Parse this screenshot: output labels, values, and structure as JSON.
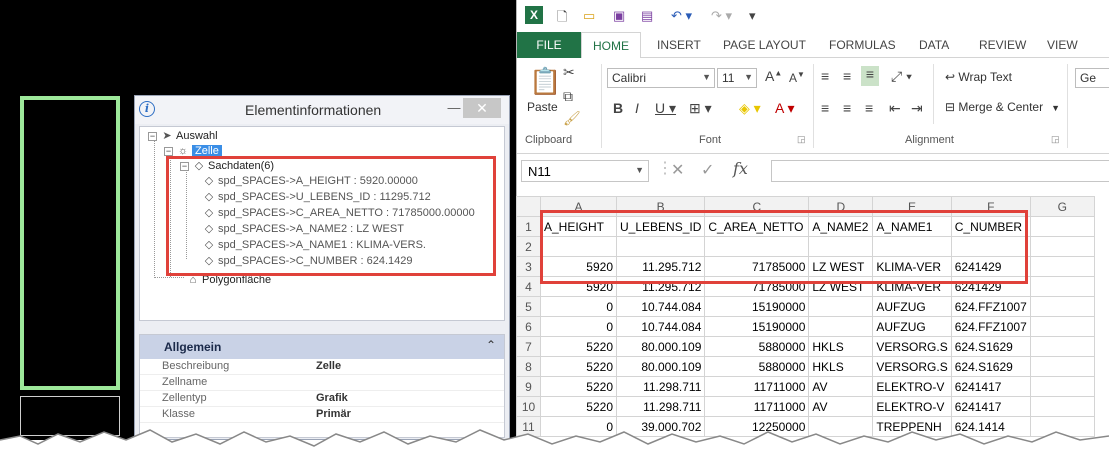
{
  "element_info": {
    "title": "Elementinformationen",
    "tree": {
      "root": "Auswahl",
      "cell": "Zelle",
      "sachdaten": "Sachdaten(6)",
      "items": [
        "spd_SPACES->A_HEIGHT : 5920.00000",
        "spd_SPACES->U_LEBENS_ID : 11295.712",
        "spd_SPACES->C_AREA_NETTO : 71785000.00000",
        "spd_SPACES->A_NAME2 : LZ WEST",
        "spd_SPACES->A_NAME1 : KLIMA-VERS.",
        "spd_SPACES->C_NUMBER : 624.1429"
      ],
      "polygon": "Polygonfläche"
    },
    "section": {
      "title": "Allgemein",
      "rows": [
        {
          "key": "Beschreibung",
          "value": "Zelle"
        },
        {
          "key": "Zellname",
          "value": ""
        },
        {
          "key": "Zellentyp",
          "value": "Grafik"
        },
        {
          "key": "Klasse",
          "value": "Primär"
        }
      ]
    }
  },
  "excel": {
    "tabs": [
      "FILE",
      "HOME",
      "INSERT",
      "PAGE LAYOUT",
      "FORMULAS",
      "DATA",
      "REVIEW",
      "VIEW"
    ],
    "ribbon": {
      "paste": "Paste",
      "clipboard": "Clipboard",
      "font_name": "Calibri",
      "font_size": "11",
      "font_group": "Font",
      "wrap_text": "Wrap Text",
      "merge_center": "Merge & Center",
      "alignment": "Alignment",
      "general_box": "Ge"
    },
    "name_box": "N11",
    "fx": "fx",
    "columns": [
      "A",
      "B",
      "C",
      "D",
      "E",
      "F",
      "G"
    ],
    "rows": [
      {
        "n": "1",
        "cells": [
          "A_HEIGHT",
          "U_LEBENS_ID",
          "C_AREA_NETTO",
          "A_NAME2",
          "A_NAME1",
          "C_NUMBER",
          ""
        ]
      },
      {
        "n": "2",
        "cells": [
          "",
          "",
          "",
          "",
          "",
          "",
          ""
        ]
      },
      {
        "n": "3",
        "cells": [
          "5920",
          "11.295.712",
          "71785000",
          "LZ WEST",
          "KLIMA-VER",
          "6241429",
          ""
        ]
      },
      {
        "n": "4",
        "cells": [
          "5920",
          "11.295.712",
          "71785000",
          "LZ WEST",
          "KLIMA-VER",
          "6241429",
          ""
        ]
      },
      {
        "n": "5",
        "cells": [
          "0",
          "10.744.084",
          "15190000",
          "",
          "AUFZUG",
          "624.FFZ1007",
          ""
        ]
      },
      {
        "n": "6",
        "cells": [
          "0",
          "10.744.084",
          "15190000",
          "",
          "AUFZUG",
          "624.FFZ1007",
          ""
        ]
      },
      {
        "n": "7",
        "cells": [
          "5220",
          "80.000.109",
          "5880000",
          "HKLS",
          "VERSORG.S",
          "624.S1629",
          ""
        ]
      },
      {
        "n": "8",
        "cells": [
          "5220",
          "80.000.109",
          "5880000",
          "HKLS",
          "VERSORG.S",
          "624.S1629",
          ""
        ]
      },
      {
        "n": "9",
        "cells": [
          "5220",
          "11.298.711",
          "11711000",
          "AV",
          "ELEKTRO-V",
          "6241417",
          ""
        ]
      },
      {
        "n": "10",
        "cells": [
          "5220",
          "11.298.711",
          "11711000",
          "AV",
          "ELEKTRO-V",
          "6241417",
          ""
        ]
      },
      {
        "n": "11",
        "cells": [
          "0",
          "39.000.702",
          "12250000",
          "",
          "TREPPENH",
          "624.1414",
          ""
        ]
      }
    ]
  }
}
